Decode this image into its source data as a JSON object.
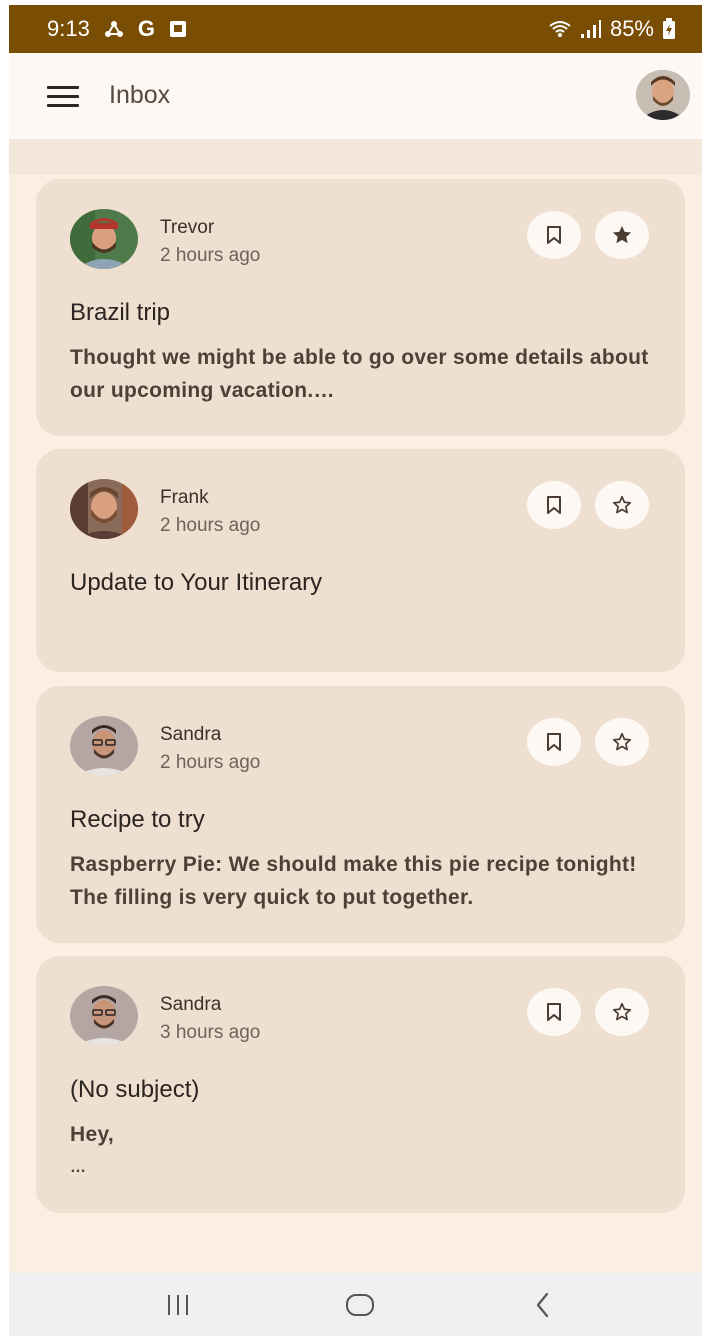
{
  "status_bar": {
    "time": "9:13",
    "battery": "85%",
    "icons": [
      "network-alert-icon",
      "google-g-icon",
      "photo-notification-icon",
      "wifi-icon",
      "signal-icon",
      "battery-charging-icon"
    ],
    "g_label": "G"
  },
  "app_bar": {
    "title": "Inbox",
    "menu_icon": "hamburger-menu-icon",
    "avatar_icon": "user-avatar"
  },
  "colors": {
    "status_bar": "#7a4d05",
    "card_bg": "#eedfd0",
    "screen_bg": "#fbeee3",
    "button_bg": "#fdf8f4"
  },
  "emails": [
    {
      "sender": "Trevor",
      "time": "2 hours ago",
      "subject": "Brazil trip",
      "preview": "Thought we might be able to go over some details about our upcoming vacation.…",
      "starred": true
    },
    {
      "sender": "Frank",
      "time": "2 hours ago",
      "subject": "Update to Your Itinerary",
      "preview": "",
      "starred": false
    },
    {
      "sender": "Sandra",
      "time": "2 hours ago",
      "subject": "Recipe to try",
      "preview": "Raspberry Pie: We should make this pie recipe tonight! The filling is very quick to put together.",
      "starred": false
    },
    {
      "sender": "Sandra",
      "time": "3 hours ago",
      "subject": "(No subject)",
      "preview_line1": "Hey,",
      "preview_line2": "…",
      "starred": false
    }
  ],
  "system_nav": {
    "icons": [
      "recents-icon",
      "home-icon",
      "back-icon"
    ]
  }
}
